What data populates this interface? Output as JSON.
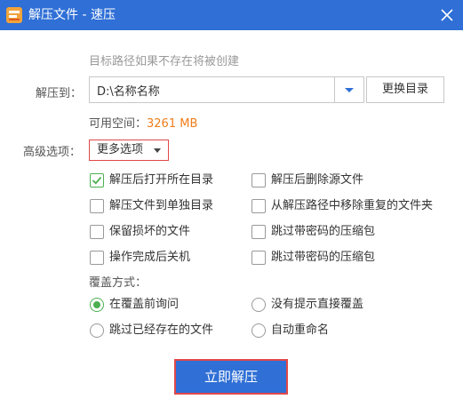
{
  "window": {
    "title": "解压文件 - 速压"
  },
  "hint": "目标路径如果不存在将被创建",
  "extract_to": {
    "label": "解压到：",
    "path": "D:\\名称名称",
    "change_button": "更换目录"
  },
  "space": {
    "label": "可用空间：",
    "value": "3261 MB",
    "value_color": "#f07d1a"
  },
  "advanced": {
    "label": "高级选项：",
    "more_button": "更多选项"
  },
  "options": [
    {
      "label": "解压后打开所在目录",
      "checked": true
    },
    {
      "label": "解压后删除源文件",
      "checked": false
    },
    {
      "label": "解压文件到单独目录",
      "checked": false
    },
    {
      "label": "从解压路径中移除重复的文件夹",
      "checked": false
    },
    {
      "label": "保留损坏的文件",
      "checked": false
    },
    {
      "label": "跳过带密码的压缩包",
      "checked": false
    },
    {
      "label": "操作完成后关机",
      "checked": false
    },
    {
      "label": "跳过带密码的压缩包",
      "checked": false
    }
  ],
  "overwrite": {
    "label": "覆盖方式：",
    "choices": [
      {
        "label": "在覆盖前询问",
        "selected": true
      },
      {
        "label": "没有提示直接覆盖",
        "selected": false
      },
      {
        "label": "跳过已经存在的文件",
        "selected": false
      },
      {
        "label": "自动重命名",
        "selected": false
      }
    ]
  },
  "extract_button": "立即解压",
  "colors": {
    "accent": "#2f6fd6",
    "check": "#4caf50",
    "highlight_border": "#e04848"
  }
}
